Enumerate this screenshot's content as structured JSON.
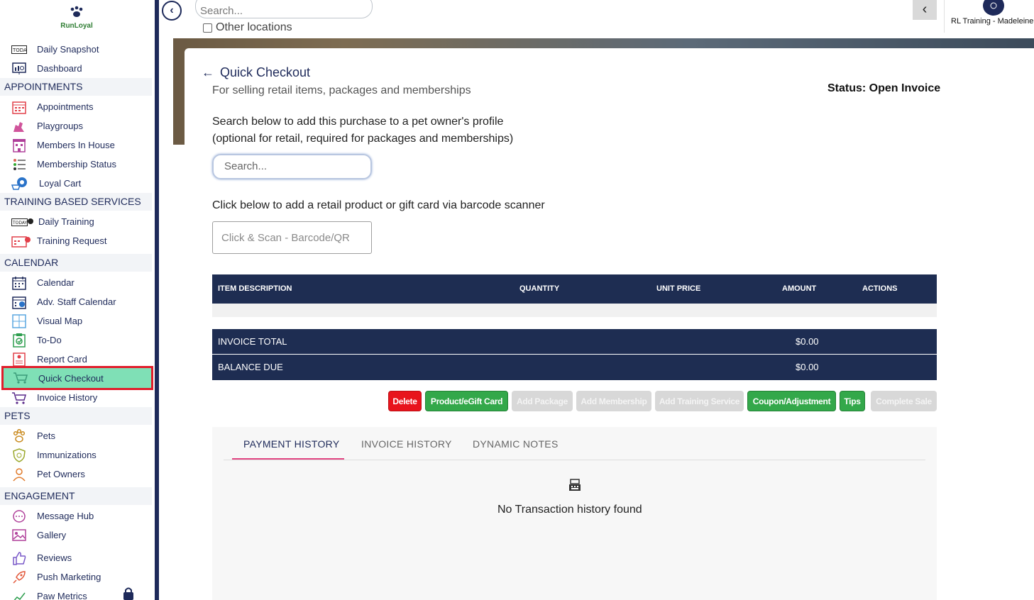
{
  "brand": {
    "name": "RunLoyal"
  },
  "sidebar": {
    "items": [
      {
        "label": "Daily Snapshot",
        "icon": "calendar-today-icon"
      },
      {
        "label": "Dashboard",
        "icon": "dashboard-icon"
      },
      {
        "section": "APPOINTMENTS"
      },
      {
        "label": "Appointments",
        "icon": "calendar-grid-icon"
      },
      {
        "label": "Playgroups",
        "icon": "dogs-icon"
      },
      {
        "label": "Members In House",
        "icon": "building-icon"
      },
      {
        "label": "Membership Status",
        "icon": "list-status-icon"
      },
      {
        "label": "Loyal Cart",
        "icon": "cart-paw-icon"
      },
      {
        "section": "TRAINING BASED SERVICES"
      },
      {
        "label": "Daily Training",
        "icon": "today-whistle-icon"
      },
      {
        "label": "Training Request",
        "icon": "calendar-whistle-icon"
      },
      {
        "section": "CALENDAR"
      },
      {
        "label": "Calendar",
        "icon": "calendar-icon"
      },
      {
        "label": "Adv. Staff Calendar",
        "icon": "staff-calendar-icon"
      },
      {
        "label": "Visual Map",
        "icon": "map-grid-icon"
      },
      {
        "label": "To-Do",
        "icon": "todo-clipboard-icon"
      },
      {
        "label": "Report Card",
        "icon": "report-card-icon"
      },
      {
        "label": "Quick Checkout",
        "icon": "cart-icon",
        "active": true
      },
      {
        "label": "Invoice History",
        "icon": "invoice-cart-icon"
      },
      {
        "section": "PETS"
      },
      {
        "label": "Pets",
        "icon": "paw-icon"
      },
      {
        "label": "Immunizations",
        "icon": "shield-icon"
      },
      {
        "label": "Pet Owners",
        "icon": "person-icon"
      },
      {
        "section": "ENGAGEMENT"
      },
      {
        "label": "Message Hub",
        "icon": "chat-icon"
      },
      {
        "label": "Gallery",
        "icon": "image-icon"
      },
      {
        "label": "Reviews",
        "icon": "thumbs-up-icon"
      },
      {
        "label": "Push Marketing",
        "icon": "rocket-icon"
      },
      {
        "label": "Paw Metrics",
        "icon": "chart-line-icon"
      }
    ]
  },
  "topbar": {
    "search_placeholder": "Search...",
    "other_locations_label": "Other locations",
    "account_name": "RL Training - Madeleine"
  },
  "checkout": {
    "title": "Quick Checkout",
    "subtitle": "For selling retail items, packages and memberships",
    "status": "Status: Open Invoice",
    "instruction_line1": "Search below to add this purchase to a pet owner's profile",
    "instruction_line2": "(optional for retail, required for packages and memberships)",
    "owner_search_placeholder": "Search...",
    "barcode_instruction": "Click below to add a retail product or gift card via barcode scanner",
    "barcode_placeholder": "Click & Scan - Barcode/QR"
  },
  "table": {
    "columns": [
      "ITEM DESCRIPTION",
      "QUANTITY",
      "UNIT PRICE",
      "AMOUNT",
      "ACTIONS"
    ],
    "rows": []
  },
  "totals": {
    "invoice_total_label": "INVOICE TOTAL",
    "invoice_total_value": "$0.00",
    "balance_due_label": "BALANCE DUE",
    "balance_due_value": "$0.00"
  },
  "actions": [
    {
      "label": "Delete",
      "style": "red"
    },
    {
      "label": "Product/eGift Card",
      "style": "green"
    },
    {
      "label": "Add Package",
      "style": "disabled"
    },
    {
      "label": "Add Membership",
      "style": "disabled"
    },
    {
      "label": "Add Training Service",
      "style": "disabled"
    },
    {
      "label": "Coupon/Adjustment",
      "style": "green"
    },
    {
      "label": "Tips",
      "style": "green"
    },
    {
      "label": "Complete Sale",
      "style": "disabled"
    }
  ],
  "history": {
    "tabs": [
      "PAYMENT HISTORY",
      "INVOICE HISTORY",
      "DYNAMIC NOTES"
    ],
    "active_tab": "PAYMENT HISTORY",
    "empty_message": "No Transaction history found"
  },
  "colors": {
    "navy": "#1e2d52",
    "active_nav": "#7fe0b6",
    "highlight_border": "#e11d2b",
    "green": "#33a84a",
    "red": "#e8141c",
    "tab_underline": "#e24583"
  }
}
